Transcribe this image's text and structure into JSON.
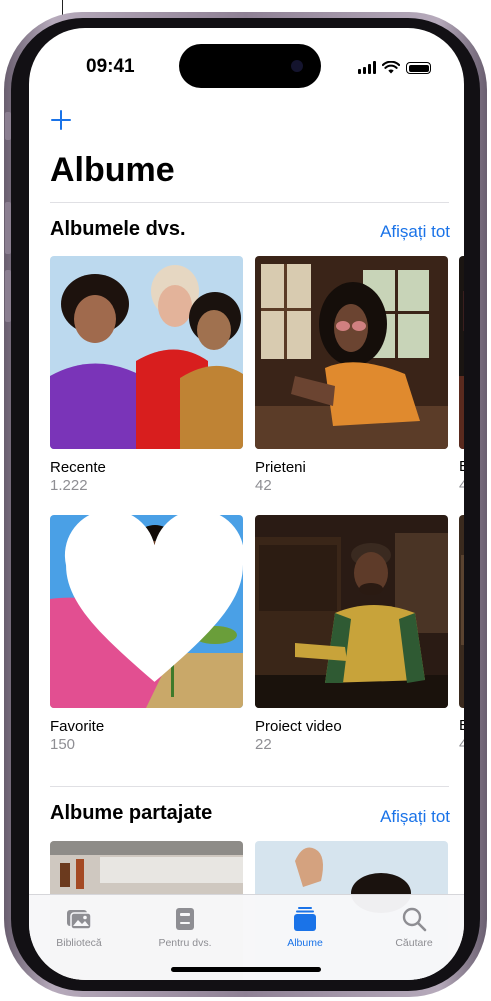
{
  "status_bar": {
    "time": "09:41"
  },
  "header": {
    "title": "Albume",
    "add_icon": "plus-icon"
  },
  "sections": {
    "your_albums": {
      "title": "Albumele dvs.",
      "see_all": "Afișați tot",
      "albums": [
        {
          "name": "Recente",
          "count": "1.222"
        },
        {
          "name": "Prieteni",
          "count": "42"
        },
        {
          "name": "Favorite",
          "count": "150"
        },
        {
          "name": "Proiect video",
          "count": "22"
        }
      ],
      "peek_labels": [
        {
          "name": "E",
          "count": "4"
        },
        {
          "name": "E",
          "count": "4"
        }
      ]
    },
    "shared_albums": {
      "title": "Albume partajate",
      "see_all": "Afișați tot"
    }
  },
  "tabbar": {
    "tabs": [
      {
        "label": "Bibliotecă",
        "icon": "photo-library-icon"
      },
      {
        "label": "Pentru dvs.",
        "icon": "for-you-icon"
      },
      {
        "label": "Albume",
        "icon": "albums-icon",
        "active": true
      },
      {
        "label": "Căutare",
        "icon": "search-icon"
      }
    ]
  },
  "colors": {
    "accent": "#1a73e8",
    "secondary_text": "#8e8e93"
  }
}
